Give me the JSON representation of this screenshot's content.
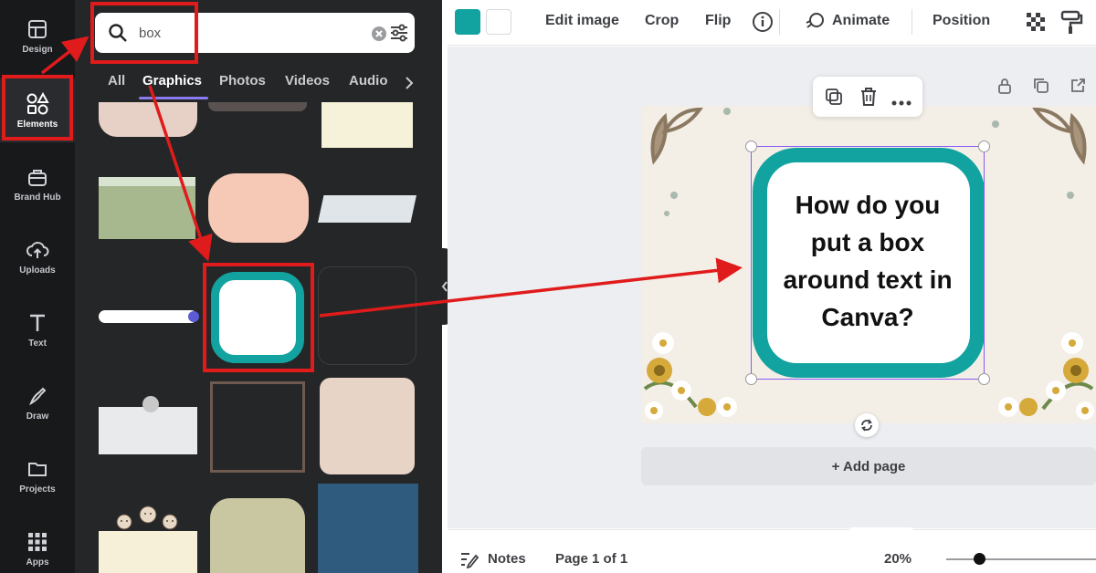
{
  "colors": {
    "rail_bg": "#18191b",
    "panel_bg": "#252627",
    "teal": "#12a3a0",
    "annotation_red": "#e01b1b",
    "selection_purple": "#8b5cf6"
  },
  "sidebar": {
    "items": [
      {
        "label": "Design",
        "icon": "layout-icon"
      },
      {
        "label": "Elements",
        "icon": "shapes-icon"
      },
      {
        "label": "Brand Hub",
        "icon": "briefcase-icon"
      },
      {
        "label": "Uploads",
        "icon": "cloud-upload-icon"
      },
      {
        "label": "Text",
        "icon": "text-icon"
      },
      {
        "label": "Draw",
        "icon": "pen-icon"
      },
      {
        "label": "Projects",
        "icon": "folder-icon"
      },
      {
        "label": "Apps",
        "icon": "grid-icon"
      }
    ]
  },
  "search": {
    "value": "box"
  },
  "panel_tabs": [
    "All",
    "Graphics",
    "Photos",
    "Videos",
    "Audio"
  ],
  "active_tab": "Graphics",
  "toolbar": {
    "edit_image": "Edit image",
    "crop": "Crop",
    "flip": "Flip",
    "animate": "Animate",
    "position": "Position"
  },
  "canvas": {
    "text_lines": [
      "How do you",
      "put a box",
      "around text in",
      "Canva?"
    ],
    "add_page": "+ Add page"
  },
  "bottombar": {
    "notes": "Notes",
    "page_indicator": "Page 1 of 1",
    "zoom": "20%"
  }
}
